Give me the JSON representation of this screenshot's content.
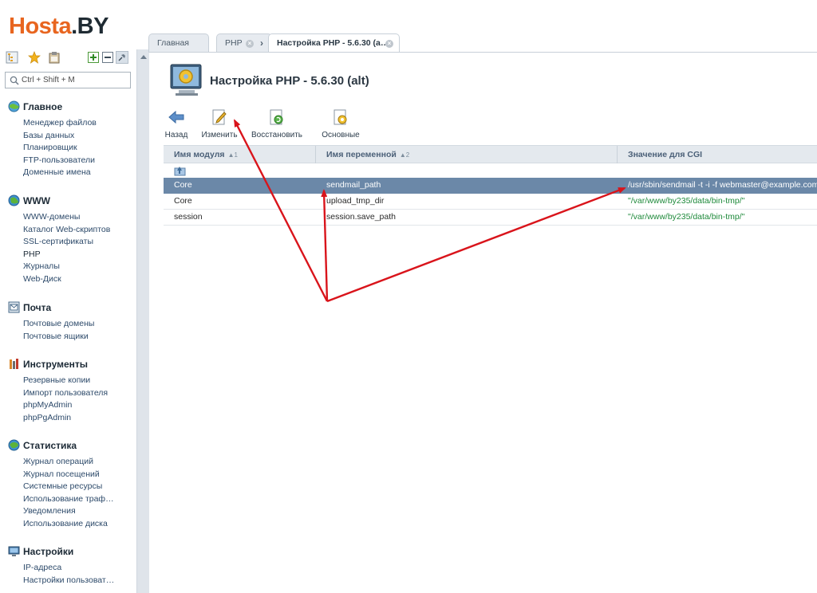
{
  "logo": {
    "part1": "Hosta",
    "part2": ".BY"
  },
  "search": {
    "placeholder": "Ctrl + Shift + M"
  },
  "sidebar": {
    "sections": [
      {
        "title": "Главное",
        "icon": "globe-icon",
        "items": [
          "Менеджер файлов",
          "Базы данных",
          "Планировщик",
          "FTP-пользователи",
          "Доменные имена"
        ]
      },
      {
        "title": "WWW",
        "icon": "www-globe-icon",
        "items": [
          "WWW-домены",
          "Каталог Web-скриптов",
          "SSL-сертификаты",
          "PHP",
          "Журналы",
          "Web-Диск"
        ]
      },
      {
        "title": "Почта",
        "icon": "mail-icon",
        "items": [
          "Почтовые домены",
          "Почтовые ящики"
        ]
      },
      {
        "title": "Инструменты",
        "icon": "tools-icon",
        "items": [
          "Резервные копии",
          "Импорт пользователя",
          "phpMyAdmin",
          "phpPgAdmin"
        ]
      },
      {
        "title": "Статистика",
        "icon": "stats-globe-icon",
        "items": [
          "Журнал операций",
          "Журнал посещений",
          "Системные ресурсы",
          "Использование траф…",
          "Уведомления",
          "Использование диска"
        ]
      },
      {
        "title": "Настройки",
        "icon": "monitor-icon",
        "items": [
          "IP-адреса",
          "Настройки пользоват…"
        ]
      }
    ],
    "active_item": "PHP"
  },
  "tabs": [
    {
      "label": "Главная"
    },
    {
      "label": "PHP"
    },
    {
      "label": "Настройка PHP - 5.6.30 (a…"
    }
  ],
  "page": {
    "title": "Настройка PHP - 5.6.30 (alt)"
  },
  "toolbar": {
    "back": "Назад",
    "edit": "Изменить",
    "restore": "Восстановить",
    "basic": "Основные"
  },
  "grid": {
    "headers": [
      {
        "label": "Имя модуля",
        "sort": "▲1"
      },
      {
        "label": "Имя переменной",
        "sort": "▲2"
      },
      {
        "label": "Значение для CGI",
        "sort": ""
      }
    ],
    "rows": [
      {
        "module": "Core",
        "variable": "sendmail_path",
        "value": "/usr/sbin/sendmail -t -i -f webmaster@example.com",
        "selected": true
      },
      {
        "module": "Core",
        "variable": "upload_tmp_dir",
        "value": "\"/var/www/by235/data/bin-tmp/\"",
        "selected": false
      },
      {
        "module": "session",
        "variable": "session.save_path",
        "value": "\"/var/www/by235/data/bin-tmp/\"",
        "selected": false
      }
    ]
  },
  "colors": {
    "logo_accent": "#e8651f",
    "logo_dark": "#1f2b33",
    "selected_row": "#6b88a8",
    "value_text": "#1f8a3b",
    "annotation_arrow": "#d9141b"
  }
}
